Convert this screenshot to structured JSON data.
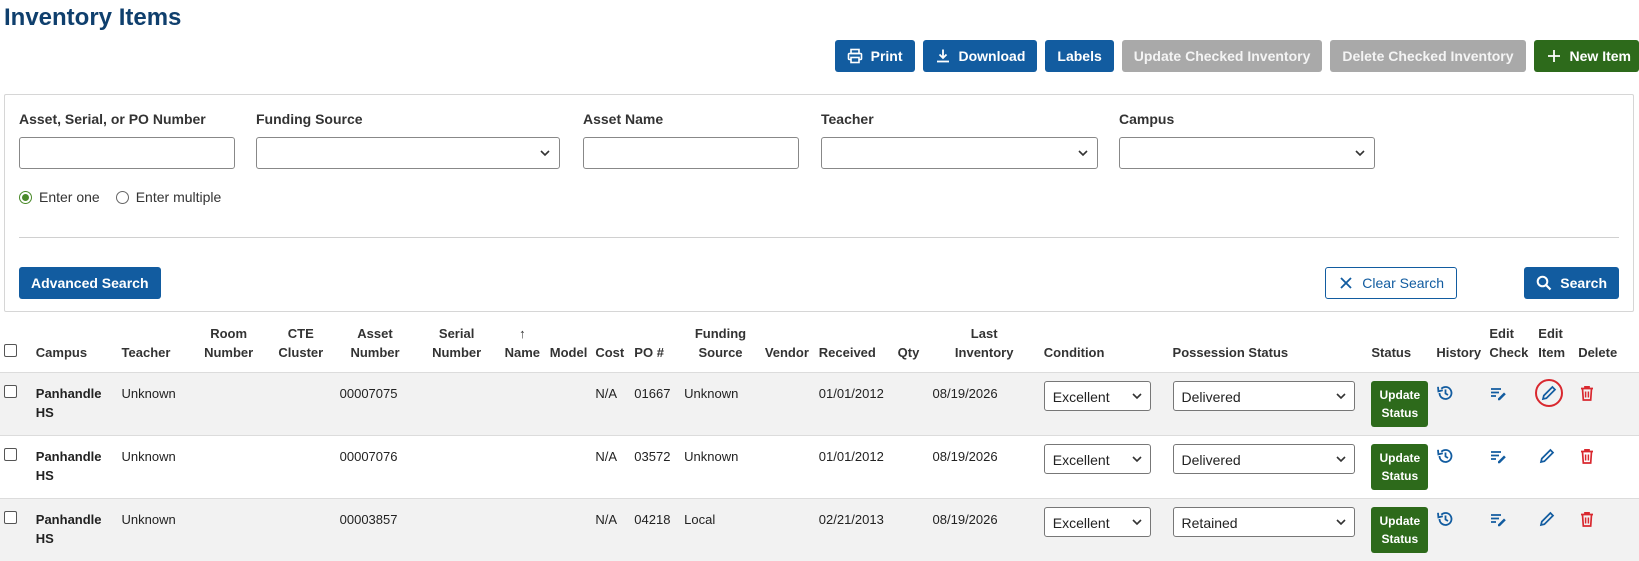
{
  "page": {
    "title": "Inventory Items"
  },
  "toolbar": {
    "print": "Print",
    "download": "Download",
    "labels": "Labels",
    "update_checked": "Update Checked Inventory",
    "delete_checked": "Delete Checked Inventory",
    "new_item": "New Item"
  },
  "filters": {
    "asset_label": "Asset, Serial, or PO Number",
    "funding_label": "Funding Source",
    "asset_name_label": "Asset Name",
    "teacher_label": "Teacher",
    "campus_label": "Campus",
    "radio_one": "Enter one",
    "radio_multiple": "Enter multiple",
    "advanced": "Advanced Search",
    "clear": "Clear Search",
    "search": "Search"
  },
  "table": {
    "headers": {
      "campus": "Campus",
      "teacher": "Teacher",
      "room_number": [
        "Room",
        "Number"
      ],
      "cte_cluster": [
        "CTE",
        "Cluster"
      ],
      "asset_number": [
        "Asset",
        "Number"
      ],
      "serial_number": [
        "Serial",
        "Number"
      ],
      "name": [
        "↑",
        "Name"
      ],
      "model": "Model",
      "cost": "Cost",
      "po": "PO #",
      "funding_source": [
        "Funding",
        "Source"
      ],
      "vendor": "Vendor",
      "received": "Received",
      "qty": "Qty",
      "last_inventory": [
        "Last",
        "Inventory"
      ],
      "condition": "Condition",
      "possession_status": "Possession Status",
      "status": "Status",
      "history": "History",
      "edit_check": [
        "Edit",
        "Check"
      ],
      "edit_item": [
        "Edit",
        "Item"
      ],
      "delete": "Delete"
    },
    "update_status_label": [
      "Update",
      "Status"
    ],
    "rows": [
      {
        "campus": [
          "Panhandle",
          "HS"
        ],
        "teacher": "Unknown",
        "asset_number": "00007075",
        "cost": "N/A",
        "po": "01667",
        "funding": "Unknown",
        "received": "01/01/2012",
        "last_inventory": "08/19/2026",
        "condition": "Excellent",
        "possession": "Delivered"
      },
      {
        "campus": [
          "Panhandle",
          "HS"
        ],
        "teacher": "Unknown",
        "asset_number": "00007076",
        "cost": "N/A",
        "po": "03572",
        "funding": "Unknown",
        "received": "01/01/2012",
        "last_inventory": "08/19/2026",
        "condition": "Excellent",
        "possession": "Delivered"
      },
      {
        "campus": [
          "Panhandle",
          "HS"
        ],
        "teacher": "Unknown",
        "asset_number": "00003857",
        "cost": "N/A",
        "po": "04218",
        "funding": "Local",
        "received": "02/21/2013",
        "last_inventory": "08/19/2026",
        "condition": "Excellent",
        "possession": "Retained"
      }
    ]
  },
  "colors": {
    "primary_blue": "#125ca0",
    "title_blue": "#0f3f6d",
    "green": "#2d6a1b",
    "disabled_gray": "#a9a9a9",
    "delete_red": "#d9282f"
  },
  "icons": {
    "print": "printer-icon",
    "download": "download-icon",
    "new_item": "plus-icon",
    "clear": "x-icon",
    "search": "search-icon",
    "history": "history-icon",
    "edit_check": "edit-note-icon",
    "edit_item": "pencil-icon",
    "delete": "trash-icon"
  }
}
